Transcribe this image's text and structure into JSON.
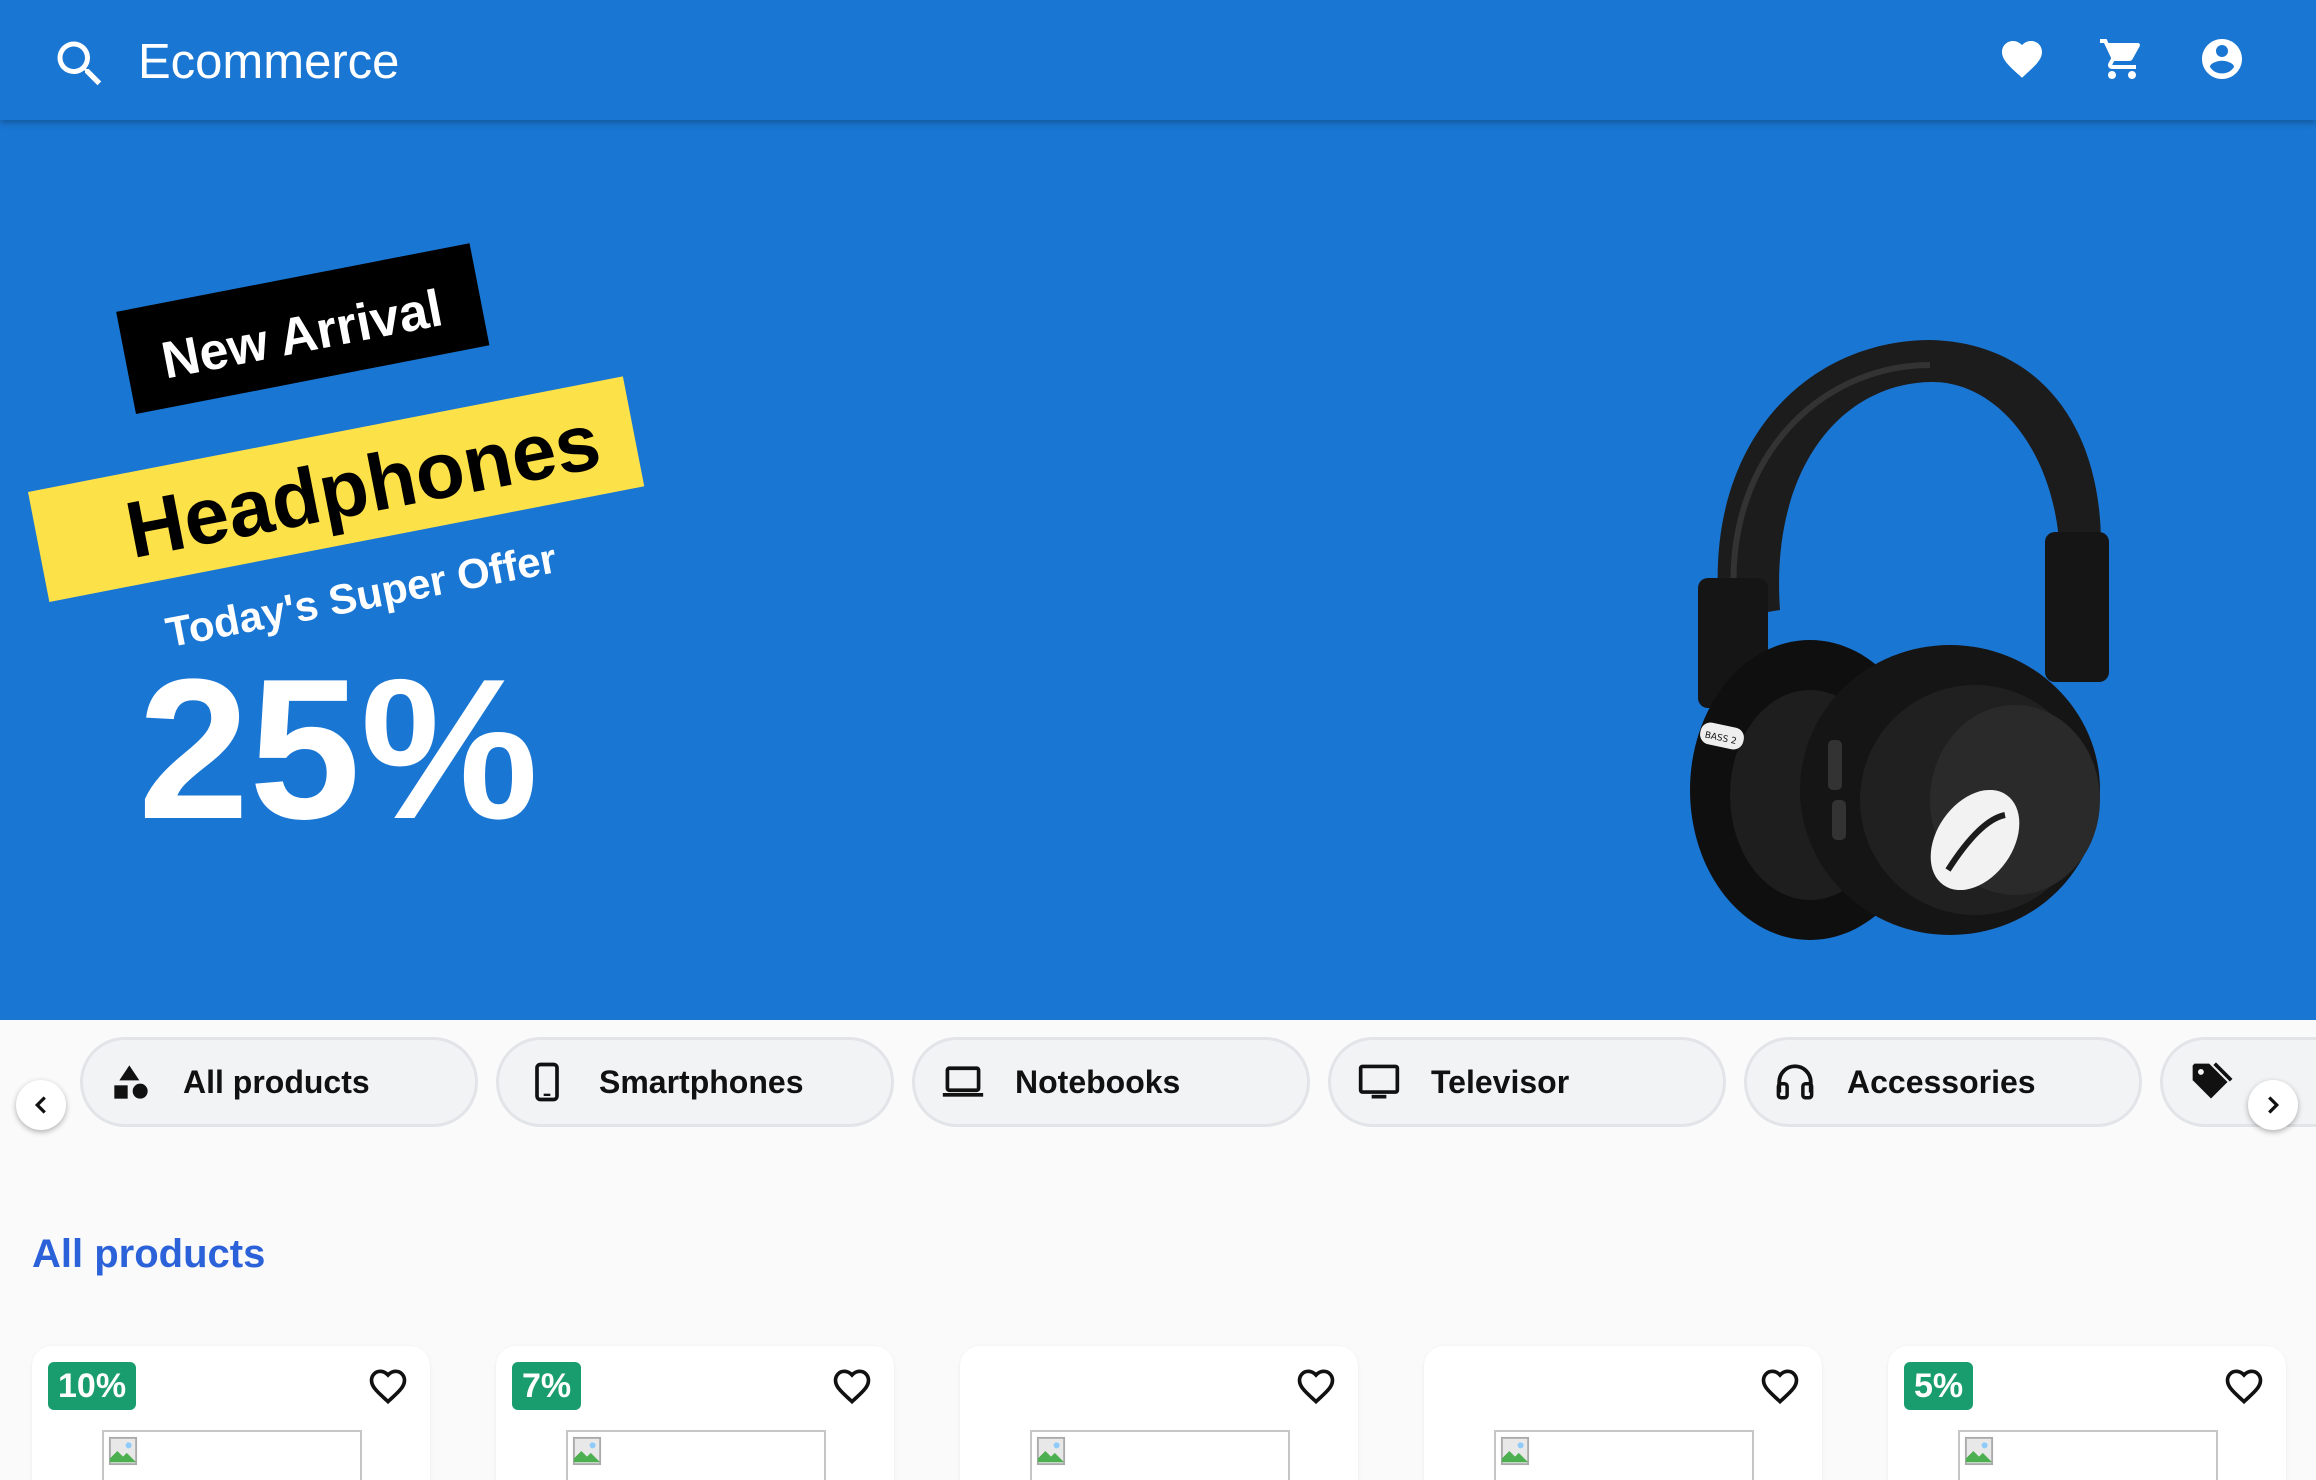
{
  "header": {
    "title": "Ecommerce",
    "icons": [
      "search-icon",
      "heart-icon",
      "cart-icon",
      "account-icon"
    ]
  },
  "hero": {
    "tag_new": "New Arrival",
    "product": "Headphones",
    "offer": "Today's Super Offer",
    "discount": "25%",
    "headphone_label": "BASS 2"
  },
  "categories": [
    {
      "label": "All products",
      "icon": "shapes-icon"
    },
    {
      "label": "Smartphones",
      "icon": "smartphone-icon"
    },
    {
      "label": "Notebooks",
      "icon": "laptop-icon"
    },
    {
      "label": "Televisor",
      "icon": "tv-icon"
    },
    {
      "label": "Accessories",
      "icon": "headphones-icon"
    },
    {
      "label": "",
      "icon": "tag-icon"
    }
  ],
  "section": {
    "title": "All products"
  },
  "products": [
    {
      "discount": "10%"
    },
    {
      "discount": "7%"
    },
    {
      "discount": ""
    },
    {
      "discount": ""
    },
    {
      "discount": "5%"
    }
  ],
  "colors": {
    "primary": "#1a76d3",
    "accent_yellow": "#fde148",
    "badge_green": "#1a9d6e",
    "section_blue": "#2b62d9"
  }
}
